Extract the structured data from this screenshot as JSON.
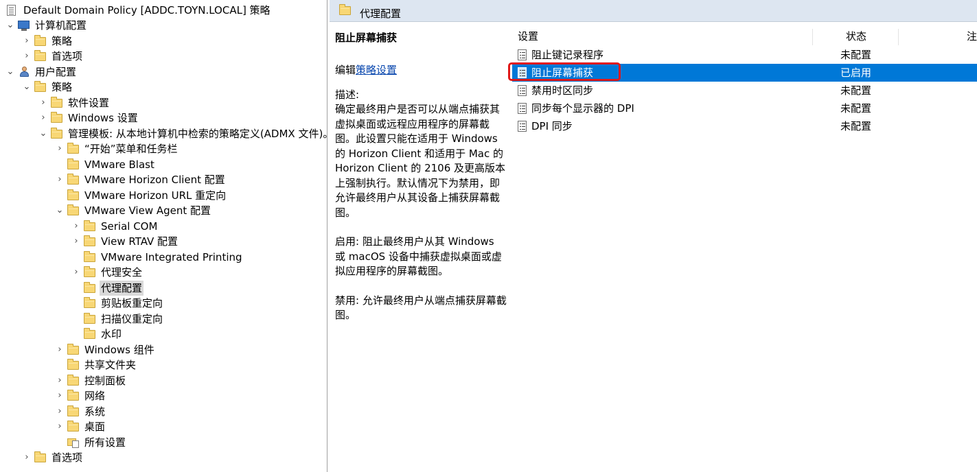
{
  "tree": {
    "root_label": "Default Domain Policy [ADDC.TOYN.LOCAL] 策略",
    "items": [
      {
        "label": "计算机配置",
        "chevron": "down"
      },
      {
        "label": "策略",
        "chevron": "right"
      },
      {
        "label": "首选项",
        "chevron": "right"
      },
      {
        "label": "用户配置",
        "chevron": "down"
      },
      {
        "label": "策略",
        "chevron": "down"
      },
      {
        "label": "软件设置",
        "chevron": "right"
      },
      {
        "label": "Windows 设置",
        "chevron": "right"
      },
      {
        "label": "管理模板: 从本地计算机中检索的策略定义(ADMX 文件)。",
        "chevron": "down"
      },
      {
        "label": "“开始”菜单和任务栏",
        "chevron": "right"
      },
      {
        "label": "VMware Blast",
        "chevron": ""
      },
      {
        "label": "VMware Horizon Client 配置",
        "chevron": "right"
      },
      {
        "label": "VMware Horizon URL 重定向",
        "chevron": ""
      },
      {
        "label": "VMware View Agent 配置",
        "chevron": "down"
      },
      {
        "label": "Serial COM",
        "chevron": "right"
      },
      {
        "label": "View RTAV 配置",
        "chevron": "right"
      },
      {
        "label": "VMware Integrated Printing",
        "chevron": ""
      },
      {
        "label": "代理安全",
        "chevron": "right"
      },
      {
        "label": "代理配置",
        "chevron": "",
        "selected": true
      },
      {
        "label": "剪贴板重定向",
        "chevron": ""
      },
      {
        "label": "扫描仪重定向",
        "chevron": ""
      },
      {
        "label": "水印",
        "chevron": ""
      },
      {
        "label": "Windows 组件",
        "chevron": "right"
      },
      {
        "label": "共享文件夹",
        "chevron": ""
      },
      {
        "label": "控制面板",
        "chevron": "right"
      },
      {
        "label": "网络",
        "chevron": "right"
      },
      {
        "label": "系统",
        "chevron": "right"
      },
      {
        "label": "桌面",
        "chevron": "right"
      },
      {
        "label": "所有设置",
        "chevron": ""
      },
      {
        "label": "首选项",
        "chevron": "right"
      }
    ]
  },
  "header": {
    "title": "代理配置"
  },
  "description": {
    "title": "阻止屏幕捕获",
    "edit_prefix": "编辑",
    "edit_link": "策略设置",
    "desc_text": "描述:\n确定最终用户是否可以从端点捕获其虚拟桌面或远程应用程序的屏幕截图。此设置只能在适用于 Windows 的 Horizon Client 和适用于 Mac 的 Horizon Client 的 2106 及更高版本上强制执行。默认情况下为禁用，即允许最终用户从其设备上捕获屏幕截图。",
    "enabled_text": "启用: 阻止最终用户从其 Windows 或 macOS 设备中捕获虚拟桌面或虚拟应用程序的屏幕截图。",
    "disabled_text": "禁用: 允许最终用户从端点捕获屏幕截图。"
  },
  "list": {
    "columns": {
      "setting": "设置",
      "state": "状态",
      "comment": "注"
    },
    "rows": [
      {
        "name": "阻止键记录程序",
        "state": "未配置"
      },
      {
        "name": "阻止屏幕捕获",
        "state": "已启用",
        "selected": true
      },
      {
        "name": "禁用时区同步",
        "state": "未配置"
      },
      {
        "name": "同步每个显示器的 DPI",
        "state": "未配置"
      },
      {
        "name": "DPI 同步",
        "state": "未配置"
      }
    ]
  },
  "colors": {
    "selection": "#0078d7",
    "highlight_box": "#e01818",
    "header_bg": "#dde6f1",
    "link": "#0645ad"
  }
}
